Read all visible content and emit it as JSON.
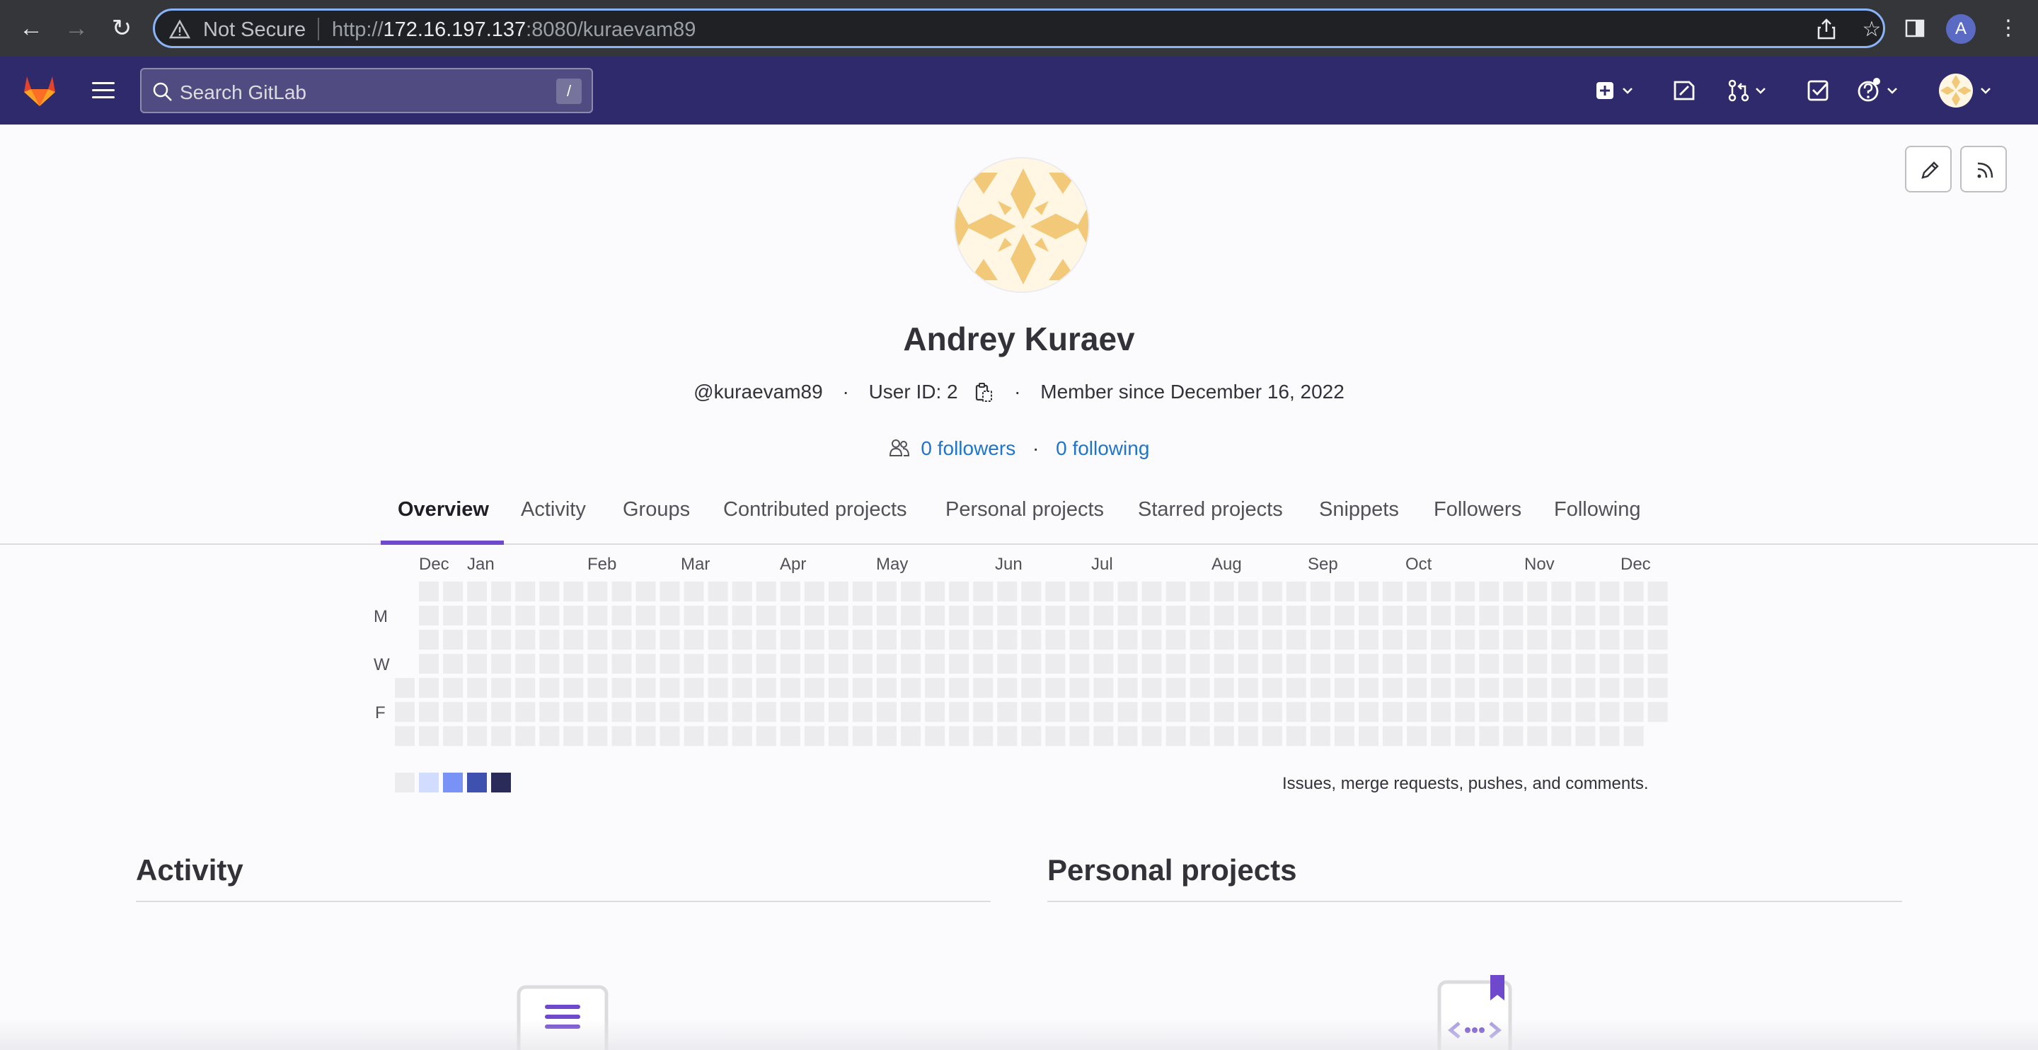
{
  "browser": {
    "security_label": "Not Secure",
    "url_prefix": "http://",
    "url_host": "172.16.197.137",
    "url_rest": ":8080/kuraevam89",
    "profile_initial": "A"
  },
  "header": {
    "search_placeholder": "Search GitLab",
    "search_shortcut": "/",
    "brand_color": "#2f2a6b"
  },
  "profile": {
    "name": "Andrey Kuraev",
    "username": "@kuraevam89",
    "user_id_label": "User ID: 2",
    "member_since": "Member since December 16, 2022",
    "followers": "0 followers",
    "following": "0 following"
  },
  "tabs": [
    {
      "label": "Overview",
      "active": true
    },
    {
      "label": "Activity",
      "active": false
    },
    {
      "label": "Groups",
      "active": false
    },
    {
      "label": "Contributed projects",
      "active": false
    },
    {
      "label": "Personal projects",
      "active": false
    },
    {
      "label": "Starred projects",
      "active": false
    },
    {
      "label": "Snippets",
      "active": false
    },
    {
      "label": "Followers",
      "active": false
    },
    {
      "label": "Following",
      "active": false
    }
  ],
  "calendar": {
    "months": [
      "Dec",
      "Jan",
      "Feb",
      "Mar",
      "Apr",
      "May",
      "Jun",
      "Jul",
      "Aug",
      "Sep",
      "Oct",
      "Nov",
      "Dec"
    ],
    "day_labels": [
      "M",
      "W",
      "F"
    ],
    "legend_colors": [
      "#ececef",
      "#d2dcff",
      "#7992f5",
      "#3f51ae",
      "#2a2b59"
    ],
    "empty_color": "#ececef",
    "legend_text": "Issues, merge requests, pushes, and comments."
  },
  "sections": {
    "activity_title": "Activity",
    "projects_title": "Personal projects"
  }
}
